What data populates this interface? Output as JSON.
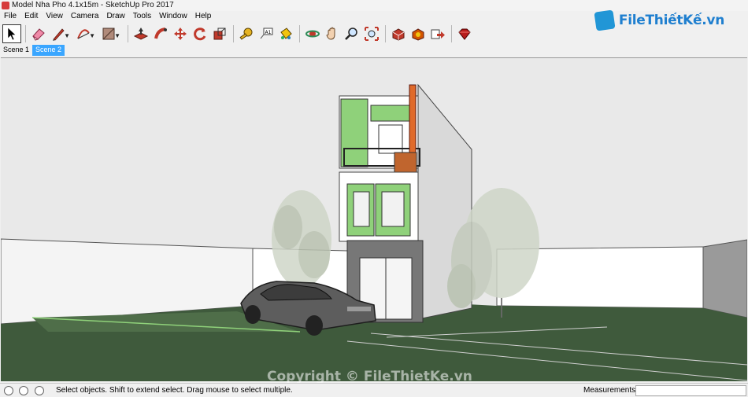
{
  "window": {
    "title": "Model Nha Pho 4.1x15m - SketchUp Pro 2017"
  },
  "logo": {
    "text": "FileThiếtKế.vn"
  },
  "menu": [
    {
      "label": "File"
    },
    {
      "label": "Edit"
    },
    {
      "label": "View"
    },
    {
      "label": "Camera"
    },
    {
      "label": "Draw"
    },
    {
      "label": "Tools"
    },
    {
      "label": "Window"
    },
    {
      "label": "Help"
    }
  ],
  "toolbar": {
    "tools": [
      {
        "icon": "select-arrow-icon",
        "color": "#000000",
        "selected": true
      },
      {
        "icon": "eraser-icon",
        "color": "#e0567a"
      },
      {
        "icon": "pencil-line-icon",
        "color": "#c0392b",
        "dropdown": true
      },
      {
        "icon": "arc-icon",
        "color": "#c0392b",
        "dropdown": true
      },
      {
        "icon": "rectangle-shape-icon",
        "color": "#8d6e63",
        "dropdown": true
      },
      {
        "icon": "push-pull-icon",
        "color": "#c0392b"
      },
      {
        "icon": "follow-me-icon",
        "color": "#c0392b"
      },
      {
        "icon": "move-icon",
        "color": "#c0392b"
      },
      {
        "icon": "rotate-icon",
        "color": "#c0392b"
      },
      {
        "icon": "scale-icon",
        "color": "#c0392b"
      },
      {
        "icon": "tape-measure-icon",
        "color": "#d4a017"
      },
      {
        "icon": "text-label-icon",
        "color": "#555555"
      },
      {
        "icon": "paint-bucket-icon",
        "color": "#c27c0e"
      },
      {
        "icon": "orbit-icon",
        "color": "#2e8b57"
      },
      {
        "icon": "pan-hand-icon",
        "color": "#d2a679"
      },
      {
        "icon": "zoom-icon",
        "color": "#333333"
      },
      {
        "icon": "zoom-extents-icon",
        "color": "#c0392b"
      },
      {
        "icon": "3d-warehouse-icon",
        "color": "#c0392b"
      },
      {
        "icon": "extension-warehouse-icon",
        "color": "#c0392b"
      },
      {
        "icon": "share-model-icon",
        "color": "#c0392b"
      },
      {
        "icon": "ruby-extension-icon",
        "color": "#b71c1c"
      }
    ]
  },
  "scenes": [
    {
      "label": "Scene 1",
      "active": false
    },
    {
      "label": "Scene 2",
      "active": true
    }
  ],
  "viewport": {
    "colors": {
      "sky": "#e9e9e9",
      "grass": "#3f5a3c",
      "wall": "#ffffff",
      "accent_green": "#8fd17a",
      "orange": "#e06a2a"
    }
  },
  "watermark": {
    "copyright": "Copyright © FileThietKe.vn"
  },
  "status": {
    "message": "Select objects. Shift to extend select. Drag mouse to select multiple.",
    "measurements_label": "Measurements",
    "measurements_value": ""
  }
}
